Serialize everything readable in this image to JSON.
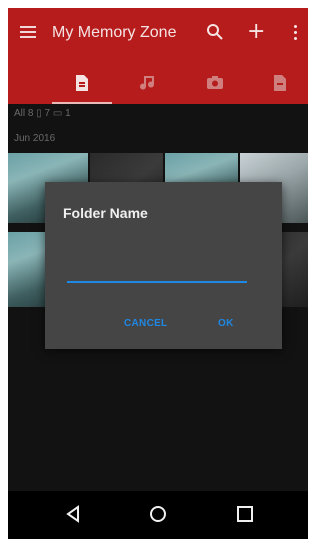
{
  "caption_partial": "",
  "app": {
    "title": "My Memory Zone",
    "icons": [
      "hamburger-menu-icon",
      "search-icon",
      "add-icon",
      "overflow-menu-icon"
    ]
  },
  "tabs": [
    {
      "name": "documents-icon",
      "active": true
    },
    {
      "name": "music-icon",
      "active": false
    },
    {
      "name": "camera-icon",
      "active": false
    },
    {
      "name": "file-icon",
      "active": false
    }
  ],
  "filters": {
    "text": "All 8  ▯ 7  ▭ 1"
  },
  "date": "Jun 2016",
  "dialog": {
    "title": "Folder Name",
    "input_value": "",
    "cancel_label": "CANCEL",
    "ok_label": "OK"
  },
  "navbar": {
    "icons": [
      "back-icon",
      "home-icon",
      "recents-icon"
    ]
  },
  "colors": {
    "appbar": "#b71c1c",
    "accent": "#1e88e5",
    "dialog_bg": "#454545",
    "screen_bg": "#121212"
  }
}
